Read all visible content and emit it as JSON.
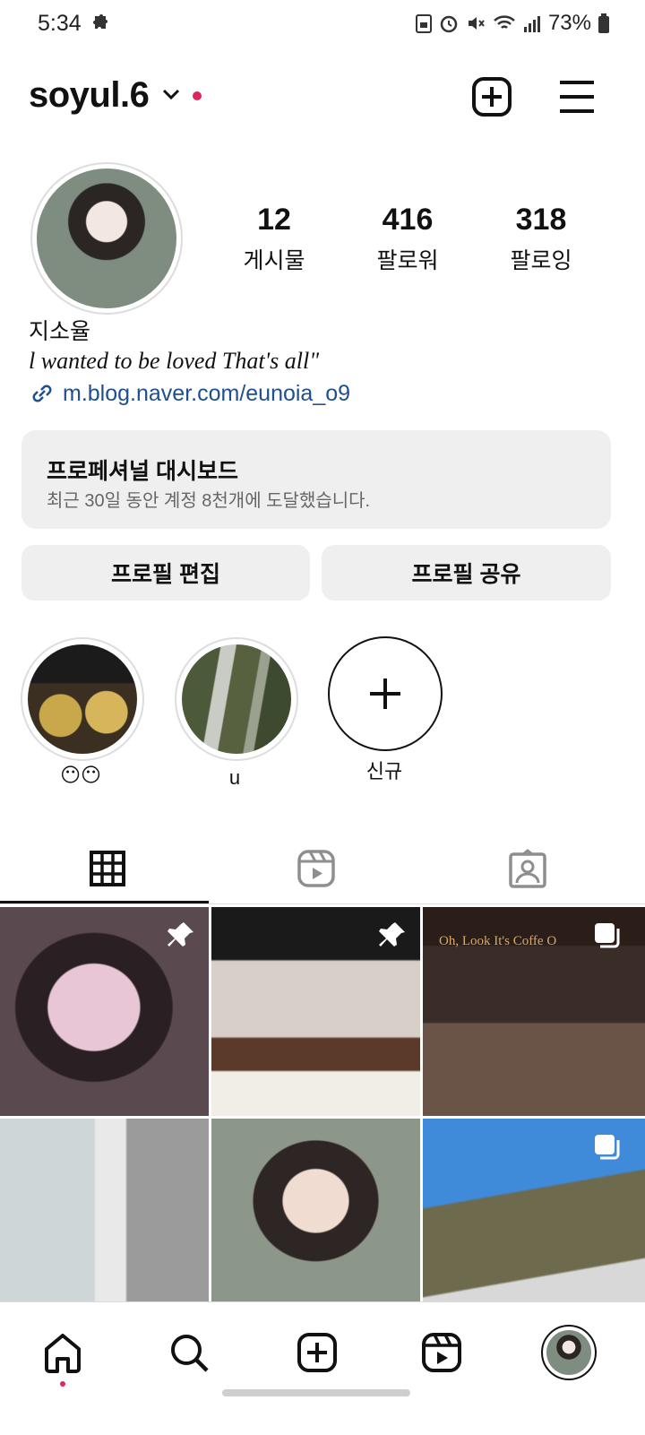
{
  "status_bar": {
    "time": "5:34",
    "battery": "73%",
    "icons": [
      "puzzle-icon",
      "save-icon",
      "alarm-icon",
      "mute-icon",
      "wifi-icon",
      "signal-icon",
      "battery-icon"
    ]
  },
  "header": {
    "username": "soyul.6",
    "icons": [
      "chevron-down-icon",
      "create-post-icon",
      "menu-icon"
    ],
    "unread_dot_color": "#e0245e"
  },
  "profile": {
    "stats": [
      {
        "value": "12",
        "label": "게시물"
      },
      {
        "value": "416",
        "label": "팔로워"
      },
      {
        "value": "318",
        "label": "팔로잉"
      }
    ],
    "name": "지소율",
    "bio": "l wanted to be loved That's all\"",
    "link": "m.blog.naver.com/eunoia_o9"
  },
  "dashboard": {
    "title": "프로페셔널 대시보드",
    "subtitle": "최근 30일 동안 계정 8천개에 도달했습니다."
  },
  "actions": {
    "edit_profile": "프로필 편집",
    "share_profile": "프로필 공유"
  },
  "highlights": [
    {
      "label": "😶😶",
      "image": "popcorn-photo"
    },
    {
      "label": "u",
      "image": "waterfall-photo"
    }
  ],
  "new_highlight_label": "신규",
  "tabs": [
    {
      "name": "posts-grid-tab",
      "icon": "grid-icon",
      "active": true
    },
    {
      "name": "reels-tab",
      "icon": "reels-icon",
      "active": false
    },
    {
      "name": "tagged-tab",
      "icon": "tagged-icon",
      "active": false
    }
  ],
  "posts": [
    {
      "pinned": true,
      "multi": false
    },
    {
      "pinned": true,
      "multi": false
    },
    {
      "pinned": false,
      "multi": true
    },
    {
      "pinned": false,
      "multi": false
    },
    {
      "pinned": false,
      "multi": false
    },
    {
      "pinned": false,
      "multi": true
    }
  ],
  "post3_sign": "Oh, Look It's Coffe O",
  "bottom_nav": [
    "home-icon",
    "search-icon",
    "create-icon",
    "reels-icon",
    "profile-avatar"
  ]
}
